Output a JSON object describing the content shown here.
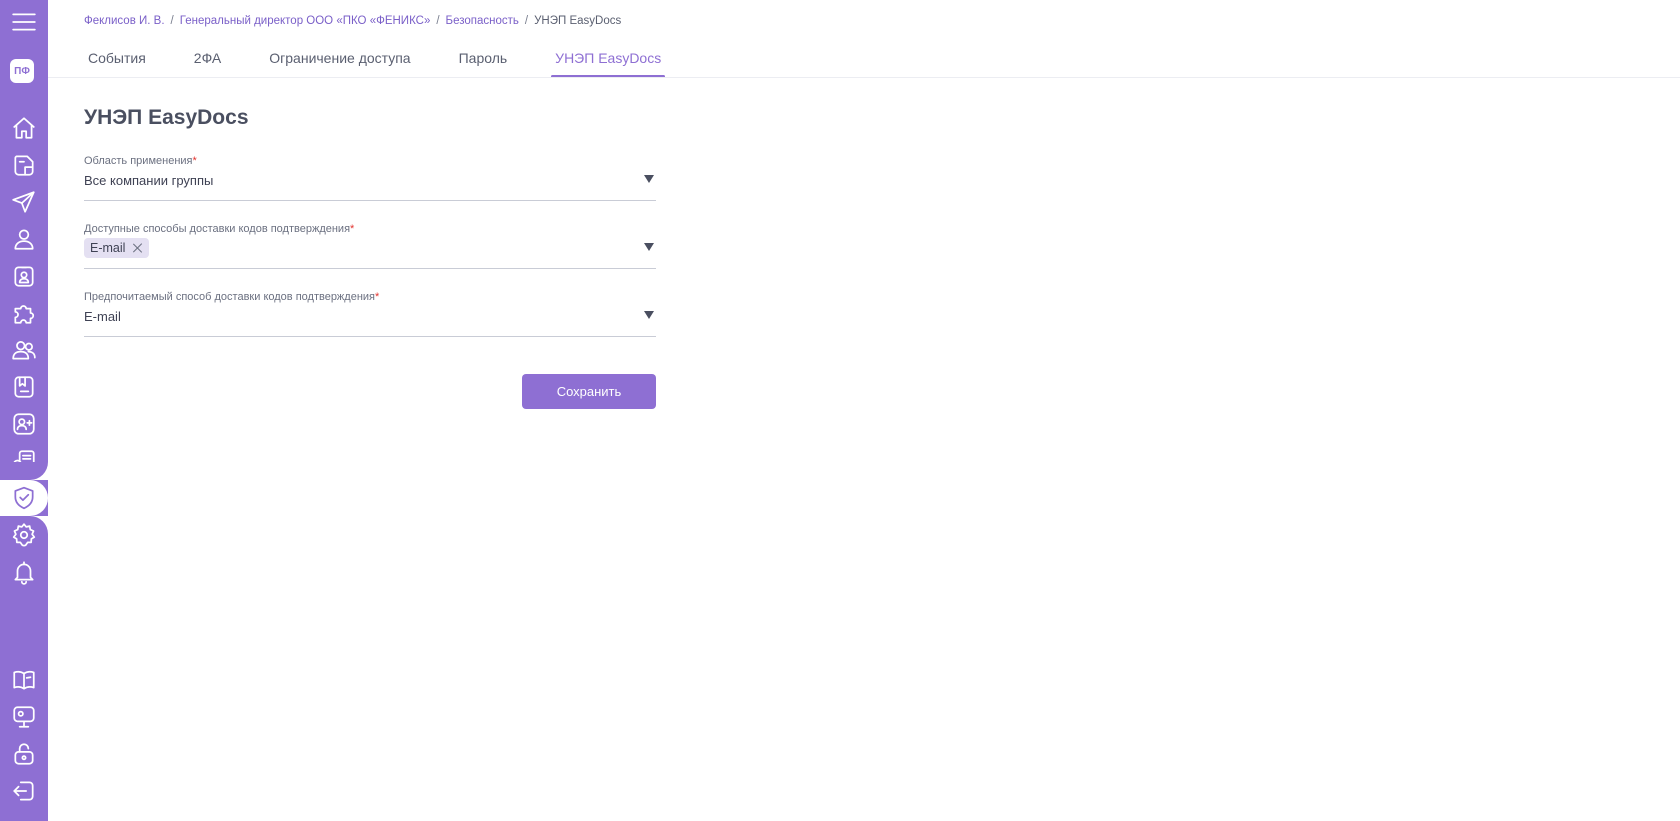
{
  "sidebar": {
    "avatar_initials": "ПФ",
    "items": [
      {
        "icon": "home-icon"
      },
      {
        "icon": "document-icon"
      },
      {
        "icon": "send-icon"
      },
      {
        "icon": "user-icon"
      },
      {
        "icon": "id-badge-icon"
      },
      {
        "icon": "puzzle-icon"
      },
      {
        "icon": "users-icon"
      },
      {
        "icon": "book-icon"
      },
      {
        "icon": "add-user-icon"
      },
      {
        "icon": "certificate-icon"
      },
      {
        "icon": "shield-check-icon",
        "active": true
      },
      {
        "icon": "gear-icon"
      },
      {
        "icon": "bell-icon"
      },
      {
        "icon": "open-book-icon"
      },
      {
        "icon": "monitor-icon"
      },
      {
        "icon": "unlock-icon"
      },
      {
        "icon": "logout-icon"
      }
    ],
    "accent_color": "#8e6fd3"
  },
  "breadcrumb": {
    "items": [
      "Феклисов И. В.",
      "Генеральный директор ООО «ПКО «ФЕНИКС»",
      "Безопасность"
    ],
    "current": "УНЭП EasyDocs",
    "separator": "/"
  },
  "tabs": [
    {
      "label": "События"
    },
    {
      "label": "2ФА"
    },
    {
      "label": "Ограничение доступа"
    },
    {
      "label": "Пароль"
    },
    {
      "label": "УНЭП EasyDocs",
      "active": true
    }
  ],
  "page": {
    "title": "УНЭП EasyDocs"
  },
  "form": {
    "scope": {
      "label": "Область применения",
      "required_mark": "*",
      "value": "Все компании группы"
    },
    "available_methods": {
      "label": "Доступные способы доставки кодов подтверждения",
      "required_mark": "*",
      "chips": [
        "E-mail"
      ]
    },
    "preferred_method": {
      "label": "Предпочитаемый способ доставки кодов подтверждения",
      "required_mark": "*",
      "value": "E-mail"
    },
    "save_label": "Сохранить"
  }
}
